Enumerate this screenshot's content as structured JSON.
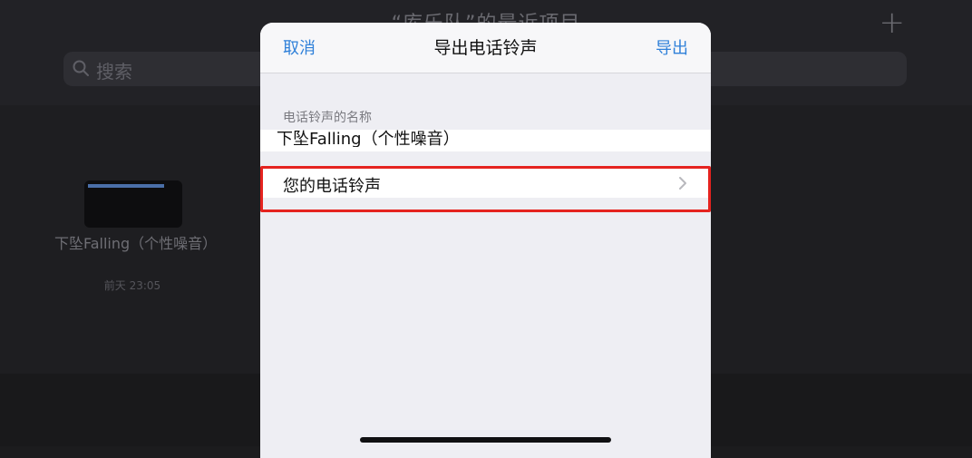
{
  "background": {
    "title": "“库乐队”的最近项目",
    "search_placeholder": "搜索",
    "project": {
      "name": "下坠Falling（个性噪音）",
      "date": "前天 23:05"
    }
  },
  "dialog": {
    "cancel_label": "取消",
    "title": "导出电话铃声",
    "export_label": "导出",
    "name_section_label": "电话铃声的名称",
    "name_value": "下坠Falling（个性噪音）",
    "ringtone_row_label": "您的电话铃声"
  },
  "colors": {
    "accent": "#2f80d9",
    "highlight": "#e5231f"
  },
  "icons": [
    "search-icon",
    "plus-icon",
    "chevron-right-icon"
  ]
}
